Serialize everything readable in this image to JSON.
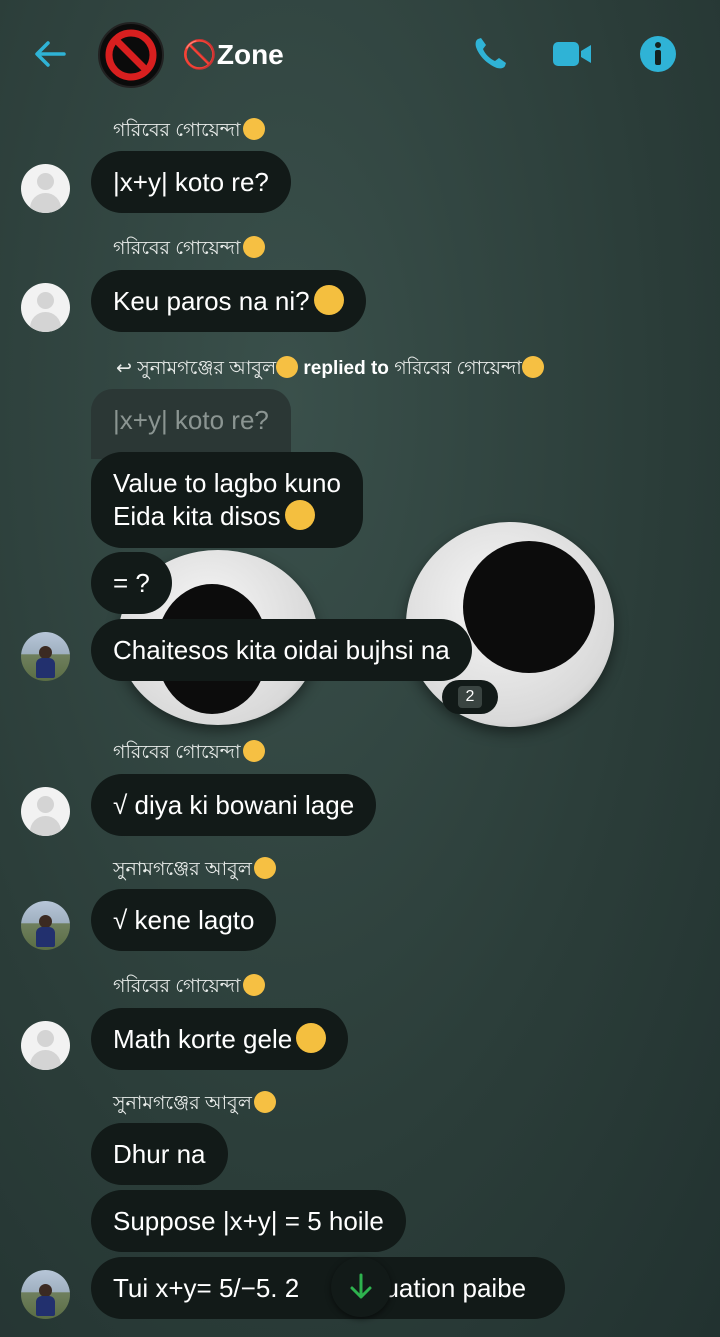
{
  "header": {
    "title": "🚫Zone",
    "icons": [
      "back-arrow-icon",
      "group-avatar",
      "prohibited-icon",
      "phone-icon",
      "video-camera-icon",
      "info-icon"
    ],
    "accent_color": "#2fb3d6"
  },
  "senders": {
    "s1": "গরিবের গোয়েন্দা",
    "s2": "সুনামগঞ্জের আবুল"
  },
  "reply_line": {
    "from": "সুনামগঞ্জের আবুল",
    "replied_to_text": "replied to",
    "to": "গরিবের গোয়েন্দা"
  },
  "messages": [
    {
      "text": "|x+y| koto re?"
    },
    {
      "text": "Keu paros na ni?"
    },
    {
      "text": "|x+y| koto re?"
    },
    {
      "line1": "Value to lagbo kuno",
      "line2": "Eida kita disos"
    },
    {
      "text": "= ?"
    },
    {
      "text": "Chaitesos kita oidai bujhsi na"
    },
    {
      "text": "√ diya ki bowani lage"
    },
    {
      "text": "√ kene lagto"
    },
    {
      "text": "Math korte gele"
    },
    {
      "text": "Dhur na"
    },
    {
      "text": "Suppose |x+y| = 5 hoile"
    },
    {
      "text_left": "Tui x+y= 5/−5. 2 ",
      "text_right": "uation paibe"
    }
  ],
  "reaction_count": "2"
}
